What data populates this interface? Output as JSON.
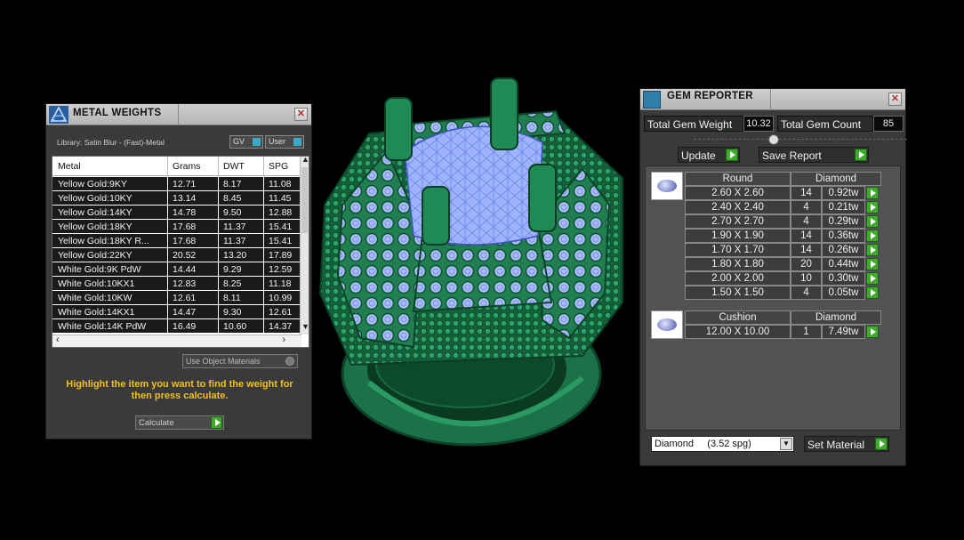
{
  "metal_weights": {
    "title": "METAL WEIGHTS",
    "library_label": "Library: Satin Blur - (Fast)-Metal",
    "toggle_gv": "GV",
    "toggle_user": "User",
    "columns": [
      "Metal",
      "Grams",
      "DWT",
      "SPG"
    ],
    "rows": [
      [
        "Yellow Gold:9KY",
        "12.71",
        "8.17",
        "11.08"
      ],
      [
        "Yellow Gold:10KY",
        "13.14",
        "8.45",
        "11.45"
      ],
      [
        "Yellow Gold:14KY",
        "14.78",
        "9.50",
        "12.88"
      ],
      [
        "Yellow Gold:18KY",
        "17.68",
        "11.37",
        "15.41"
      ],
      [
        "Yellow Gold:18KY R...",
        "17.68",
        "11.37",
        "15.41"
      ],
      [
        "Yellow Gold:22KY",
        "20.52",
        "13.20",
        "17.89"
      ],
      [
        "White Gold:9K PdW",
        "14.44",
        "9.29",
        "12.59"
      ],
      [
        "White Gold:10KX1",
        "12.83",
        "8.25",
        "11.18"
      ],
      [
        "White Gold:10KW",
        "12.61",
        "8.11",
        "10.99"
      ],
      [
        "White Gold:14KX1",
        "14.47",
        "9.30",
        "12.61"
      ],
      [
        "White Gold:14K PdW",
        "16.49",
        "10.60",
        "14.37"
      ]
    ],
    "use_object_materials": "Use Object Materials",
    "hint": "Highlight the item you want to find the weight for then press calculate.",
    "calculate_label": "Calculate"
  },
  "gem_reporter": {
    "title": "GEM REPORTER",
    "total_weight_label": "Total Gem Weight",
    "total_weight_value": "10.32",
    "total_count_label": "Total Gem Count",
    "total_count_value": "85",
    "update_label": "Update",
    "save_report_label": "Save Report",
    "groups": [
      {
        "shape": "Round",
        "material": "Diamond",
        "rows": [
          [
            "2.60 X 2.60",
            "14",
            "0.92tw"
          ],
          [
            "2.40 X 2.40",
            "4",
            "0.21tw"
          ],
          [
            "2.70 X 2.70",
            "4",
            "0.29tw"
          ],
          [
            "1.90 X 1.90",
            "14",
            "0.36tw"
          ],
          [
            "1.70 X 1.70",
            "14",
            "0.26tw"
          ],
          [
            "1.80 X 1.80",
            "20",
            "0.44tw"
          ],
          [
            "2.00 X 2.00",
            "10",
            "0.30tw"
          ],
          [
            "1.50 X 1.50",
            "4",
            "0.05tw"
          ]
        ]
      },
      {
        "shape": "Cushion",
        "material": "Diamond",
        "rows": [
          [
            "12.00 X 10.00",
            "1",
            "7.49tw"
          ]
        ]
      }
    ],
    "material_select": "Diamond     (3.52 spg)",
    "set_material_label": "Set Material"
  },
  "colors": {
    "accent_green": "#3faa2c",
    "hint_yellow": "#f2c118",
    "ring_green": "#1e7a4e",
    "gem_blue": "#9fb4ff"
  }
}
